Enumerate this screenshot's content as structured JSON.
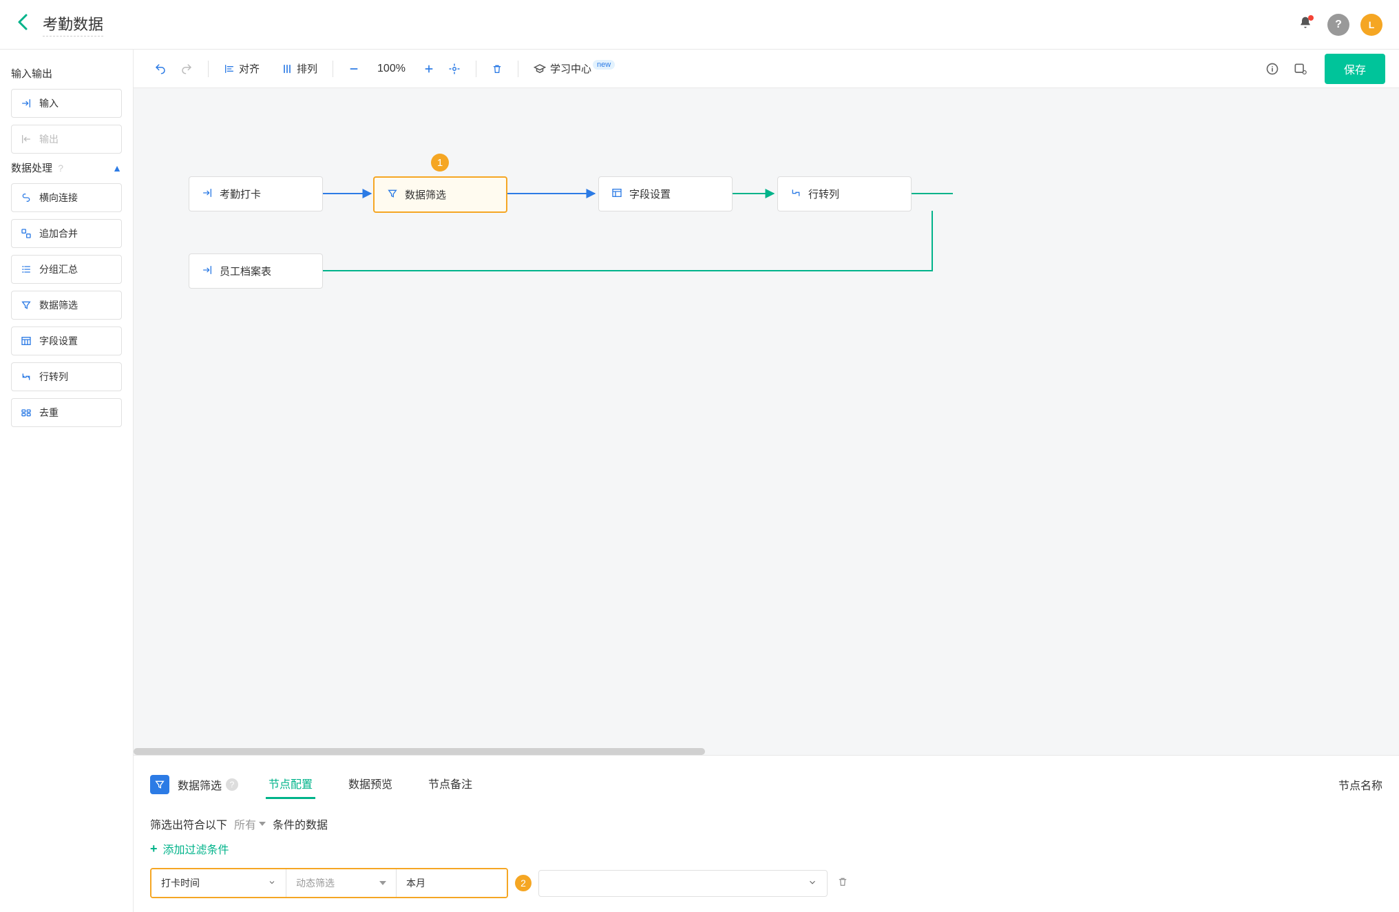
{
  "header": {
    "title": "考勤数据",
    "avatar_letter": "L"
  },
  "sidebar": {
    "section_io": "输入输出",
    "input_label": "输入",
    "output_label": "输出",
    "section_process": "数据处理",
    "items": [
      {
        "label": "横向连接"
      },
      {
        "label": "追加合并"
      },
      {
        "label": "分组汇总"
      },
      {
        "label": "数据筛选"
      },
      {
        "label": "字段设置"
      },
      {
        "label": "行转列"
      },
      {
        "label": "去重"
      }
    ]
  },
  "toolbar": {
    "align": "对齐",
    "arrange": "排列",
    "zoom": "100%",
    "learn": "学习中心",
    "learn_badge": "new",
    "save": "保存"
  },
  "canvas": {
    "nodes": {
      "n1": "考勤打卡",
      "n2": "数据筛选",
      "n3": "字段设置",
      "n4": "行转列",
      "n5": "员工档案表"
    },
    "marker1": "1"
  },
  "panel": {
    "title": "数据筛选",
    "tabs": {
      "config": "节点配置",
      "preview": "数据预览",
      "note": "节点备注"
    },
    "node_name_label": "节点名称",
    "filter_prefix": "筛选出符合以下",
    "filter_all": "所有",
    "filter_suffix": "条件的数据",
    "add_filter": "添加过滤条件",
    "row": {
      "field": "打卡时间",
      "mode": "动态筛选",
      "value": "本月"
    },
    "marker2": "2"
  }
}
